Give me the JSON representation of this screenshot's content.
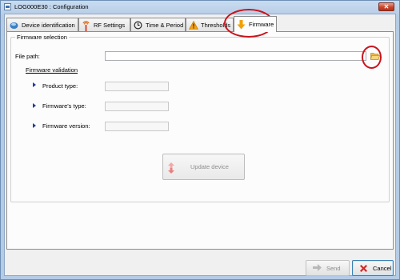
{
  "window": {
    "title": "LOG000E30 : Configuration",
    "close_glyph": "✕"
  },
  "tabs": [
    {
      "label": "Device identification",
      "icon": "device-identification-icon",
      "active": false
    },
    {
      "label": "RF Settings",
      "icon": "rf-antenna-icon",
      "active": false
    },
    {
      "label": "Time & Period",
      "icon": "clock-icon",
      "active": false
    },
    {
      "label": "Thresholds",
      "icon": "warning-triangle-icon",
      "active": false
    },
    {
      "label": "Firmware",
      "icon": "download-arrow-icon",
      "active": true
    }
  ],
  "firmware": {
    "group_title": "Firmware selection",
    "file_path_label": "File path:",
    "file_path_value": "",
    "browse_icon": "open-folder-icon",
    "validation_link": "Firmware validation",
    "fields": [
      {
        "label": "Product type:",
        "value": ""
      },
      {
        "label": "Firmware's type:",
        "value": ""
      },
      {
        "label": "Firmware version:",
        "value": ""
      }
    ],
    "update_button": {
      "label": "Update device",
      "icon": "update-arrow-icon",
      "enabled": false
    }
  },
  "footer": {
    "send_button": {
      "label": "Send",
      "icon": "send-arrow-icon",
      "enabled": false
    },
    "cancel_button": {
      "label": "Cancel",
      "icon": "cancel-x-icon",
      "enabled": true
    }
  },
  "colors": {
    "window_frame": "#b4cbe6",
    "highlight_ring": "#c8141e",
    "cancel_icon": "#d42424",
    "firmware_icon": "#f0a000"
  }
}
